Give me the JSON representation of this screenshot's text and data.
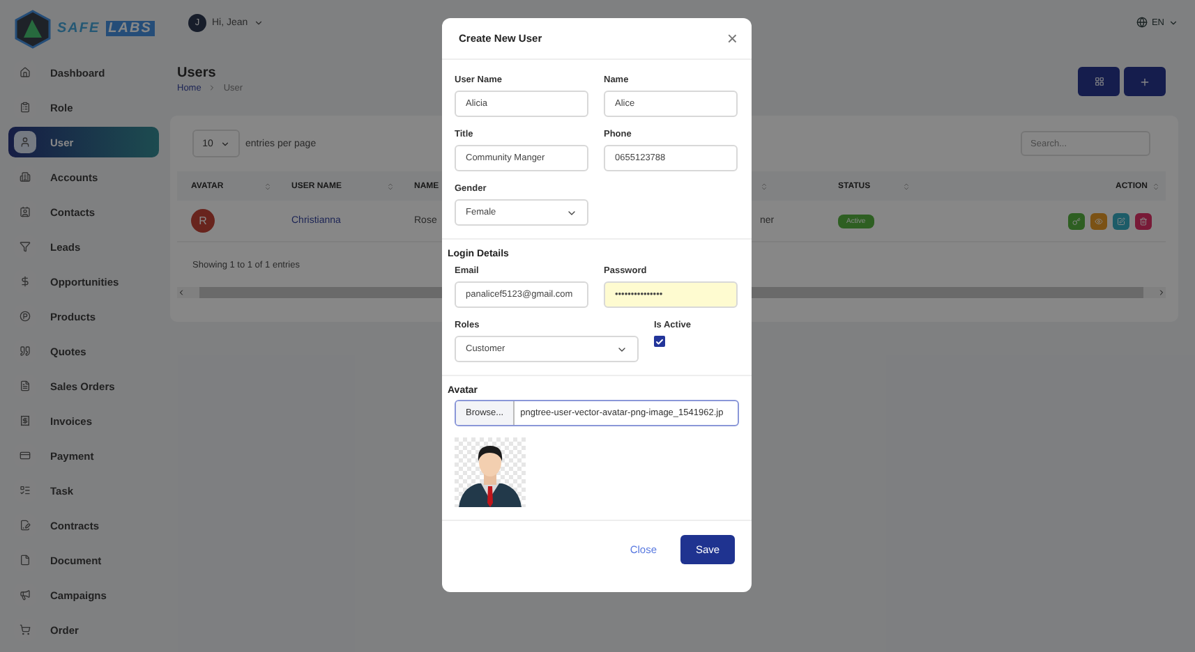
{
  "brand": {
    "first": "SAFE",
    "second": "LABS"
  },
  "header": {
    "user_initial": "J",
    "greeting": "Hi, Jean",
    "language": "EN"
  },
  "sidebar": {
    "items": [
      {
        "label": "Dashboard",
        "selected": false
      },
      {
        "label": "Role",
        "selected": false
      },
      {
        "label": "User",
        "selected": true
      },
      {
        "label": "Accounts",
        "selected": false
      },
      {
        "label": "Contacts",
        "selected": false
      },
      {
        "label": "Leads",
        "selected": false
      },
      {
        "label": "Opportunities",
        "selected": false
      },
      {
        "label": "Products",
        "selected": false
      },
      {
        "label": "Quotes",
        "selected": false
      },
      {
        "label": "Sales Orders",
        "selected": false
      },
      {
        "label": "Invoices",
        "selected": false
      },
      {
        "label": "Payment",
        "selected": false
      },
      {
        "label": "Task",
        "selected": false
      },
      {
        "label": "Contracts",
        "selected": false
      },
      {
        "label": "Document",
        "selected": false
      },
      {
        "label": "Campaigns",
        "selected": false
      },
      {
        "label": "Order",
        "selected": false
      }
    ]
  },
  "page": {
    "title": "Users",
    "breadcrumb": [
      "Home",
      "User"
    ]
  },
  "table": {
    "entries_per_page": "10",
    "entries_label": "entries per page",
    "search_placeholder": "Search...",
    "columns": [
      {
        "label": "AVATAR"
      },
      {
        "label": "USER NAME"
      },
      {
        "label": "NAME"
      },
      {},
      {
        "label": "STATUS"
      },
      {
        "label": "ACTION"
      }
    ],
    "rows": [
      {
        "avatar_initial": "R",
        "user_name": "Christianna",
        "name": "Rose",
        "column_4": "ner",
        "status": "Active"
      }
    ],
    "footer": "Showing 1 to 1 of 1 entries"
  },
  "modal": {
    "title": "Create New User",
    "close": "×",
    "sections": [
      {
        "fields": [
          {
            "kind": "text",
            "label": "User Name",
            "value": "Alicia"
          },
          {
            "kind": "text",
            "label": "Name",
            "value": "Alice"
          },
          {
            "kind": "text",
            "label": "Title",
            "value": "Community Manger"
          },
          {
            "kind": "text",
            "label": "Phone",
            "value": "0655123788"
          },
          {
            "kind": "select",
            "label": "Gender",
            "value": "Female"
          }
        ]
      },
      {
        "heading": "Login Details",
        "fields": [
          {
            "kind": "text",
            "label": "Email",
            "value": "panalicef5123@gmail.com"
          },
          {
            "kind": "password",
            "label": "Password",
            "value": "•••••••••••••••"
          },
          {
            "kind": "select",
            "label": "Roles",
            "value": "Customer"
          },
          {
            "kind": "checkbox",
            "label": "Is Active",
            "checked": true
          }
        ]
      },
      {
        "heading": "Avatar",
        "file": {
          "button": "Browse...",
          "filename": "pngtree-user-vector-avatar-png-image_1541962.jp"
        }
      }
    ],
    "buttons": [
      {
        "kind": "link",
        "label": "Close"
      },
      {
        "kind": "primary",
        "label": "Save"
      }
    ]
  }
}
